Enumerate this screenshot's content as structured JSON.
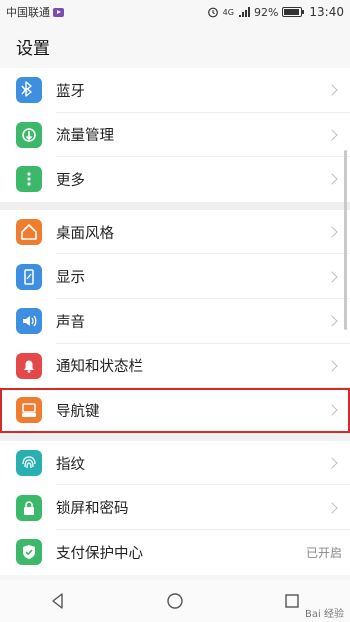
{
  "status_bar": {
    "carrier": "中国联通",
    "network": "4G",
    "battery": "92%",
    "battery_level": 0.92,
    "time": "13:40"
  },
  "title": "设置",
  "groups": [
    {
      "items": [
        {
          "id": "bluetooth",
          "label": "蓝牙",
          "icon": "bluetooth-icon",
          "color": "#3f8fe0"
        },
        {
          "id": "data-usage",
          "label": "流量管理",
          "icon": "data-usage-icon",
          "color": "#3cb86a"
        },
        {
          "id": "more",
          "label": "更多",
          "icon": "more-dots-icon",
          "color": "#3cb86a"
        }
      ]
    },
    {
      "items": [
        {
          "id": "home-style",
          "label": "桌面风格",
          "icon": "home-icon",
          "color": "#ee7d2f"
        },
        {
          "id": "display",
          "label": "显示",
          "icon": "display-icon",
          "color": "#3f8fe0"
        },
        {
          "id": "sound",
          "label": "声音",
          "icon": "speaker-icon",
          "color": "#3f8fe0"
        },
        {
          "id": "notifications",
          "label": "通知和状态栏",
          "icon": "bell-icon",
          "color": "#e54848"
        },
        {
          "id": "navigation-key",
          "label": "导航键",
          "icon": "nav-key-icon",
          "color": "#ee7d2f",
          "highlighted": true
        }
      ]
    },
    {
      "items": [
        {
          "id": "fingerprint",
          "label": "指纹",
          "icon": "fingerprint-icon",
          "color": "#28b0b0"
        },
        {
          "id": "lock-screen",
          "label": "锁屏和密码",
          "icon": "lock-icon",
          "color": "#3cb86a"
        },
        {
          "id": "payment-protection",
          "label": "支付保护中心",
          "icon": "shield-check-icon",
          "color": "#3cb86a",
          "value": "已开启"
        }
      ]
    }
  ],
  "nav": {
    "back": "back-icon",
    "home": "home-circle-icon",
    "recent": "recent-square-icon"
  },
  "watermark": "Bai 经验"
}
